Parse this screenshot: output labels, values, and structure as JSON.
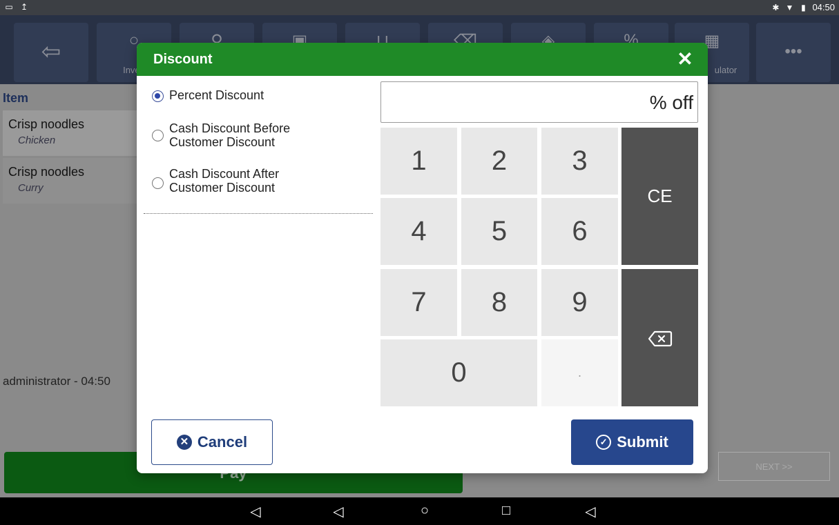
{
  "status_bar": {
    "time": "04:50"
  },
  "toolbar": {
    "buttons": [
      {
        "label": "",
        "icon": "back-arrow-icon"
      },
      {
        "label": "Inven",
        "icon": "search-icon"
      },
      {
        "label": "",
        "icon": "pin-icon"
      },
      {
        "label": "",
        "icon": "printer-icon"
      },
      {
        "label": "",
        "icon": "cart-icon"
      },
      {
        "label": "",
        "icon": "trash-icon"
      },
      {
        "label": "",
        "icon": "tag-icon"
      },
      {
        "label": "",
        "icon": "percent-icon"
      },
      {
        "label": "ulator",
        "icon": "calculator-icon"
      },
      {
        "label": "",
        "icon": "more-icon"
      }
    ]
  },
  "order": {
    "header": "Item",
    "items": [
      {
        "name": "Crisp noodles",
        "option": "Chicken"
      },
      {
        "name": "Crisp noodles",
        "option": "Curry"
      }
    ],
    "user_line": "administrator - 04:50",
    "pay_label": "Pay",
    "next_label": "NEXT >>"
  },
  "dialog": {
    "title": "Discount",
    "close_icon": "close-icon",
    "options": [
      {
        "label": "Percent Discount",
        "checked": true
      },
      {
        "label_line1": "Cash Discount Before",
        "label_line2": "Customer Discount",
        "checked": false
      },
      {
        "label_line1": "Cash Discount After",
        "label_line2": "Customer Discount",
        "checked": false
      }
    ],
    "amount_suffix": "% off",
    "keypad": {
      "k1": "1",
      "k2": "2",
      "k3": "3",
      "k4": "4",
      "k5": "5",
      "k6": "6",
      "k7": "7",
      "k8": "8",
      "k9": "9",
      "k0": "0",
      "dot": ".",
      "ce": "CE",
      "backspace_icon": "backspace-icon"
    },
    "cancel_label": "Cancel",
    "submit_label": "Submit"
  },
  "colors": {
    "header_green": "#1f8a27",
    "primary_blue": "#27478d",
    "keypad_dark": "#525252"
  }
}
